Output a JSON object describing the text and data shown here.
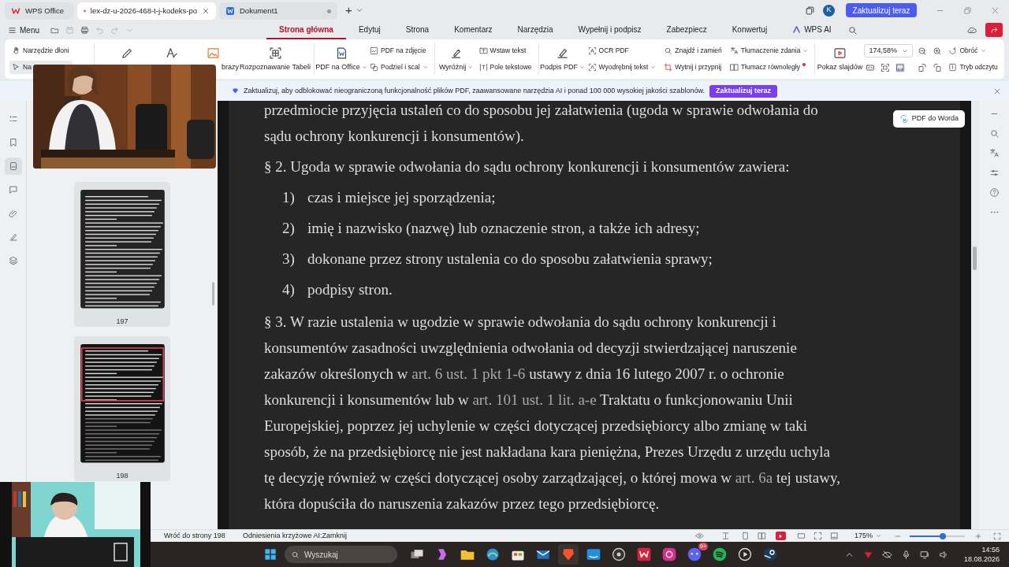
{
  "title_bar": {
    "tabs": [
      {
        "label": "WPS Office",
        "selected": false,
        "close": false,
        "kind": "wps"
      },
      {
        "label": "lex-dz-u-2026-468-t-j-kodeks-po",
        "selected": true,
        "close": true,
        "kind": "pdf"
      },
      {
        "label": "Dokument1",
        "selected": false,
        "close": false,
        "kind": "word"
      }
    ],
    "new_tab": "+",
    "avatar": "K",
    "upgrade_button": "Zaktualizuj teraz"
  },
  "menu_bar": {
    "menu": "Menu",
    "tabs": [
      {
        "label": "Strona główna",
        "selected": true
      },
      {
        "label": "Edytuj",
        "selected": false
      },
      {
        "label": "Strona",
        "selected": false
      },
      {
        "label": "Komentarz",
        "selected": false
      },
      {
        "label": "Narzędzia",
        "selected": false
      },
      {
        "label": "Wypełnij i podpisz",
        "selected": false
      },
      {
        "label": "Zabezpiecz",
        "selected": false
      },
      {
        "label": "Konwertuj",
        "selected": false
      },
      {
        "label": "WPS AI",
        "selected": false
      }
    ]
  },
  "ribbon": {
    "groups": [
      [
        {
          "kind": "col",
          "items": [
            {
              "label": "Narzędzie dłoni",
              "selected": false
            },
            {
              "label": "Na",
              "selected": true
            }
          ]
        }
      ],
      [
        {
          "kind": "big"
        },
        {
          "kind": "big"
        },
        {
          "kind": "partial",
          "label": "brazy"
        },
        {
          "kind": "big",
          "label": "Rozpoznawanie Tabeli"
        }
      ],
      [
        {
          "kind": "big",
          "label": "PDF na Office",
          "dropdown": true
        },
        {
          "kind": "col",
          "items": [
            {
              "label": "PDF na zdjęcie"
            },
            {
              "label": "Podziel i scal",
              "dropdown": true
            }
          ]
        }
      ],
      [
        {
          "kind": "big",
          "label": "Wyróżnij",
          "dropdown": true
        },
        {
          "kind": "col",
          "items": [
            {
              "label": "Wstaw tekst"
            },
            {
              "label": "Pole tekstowe"
            }
          ]
        }
      ],
      [
        {
          "kind": "big",
          "label": "Podpis PDF",
          "dropdown": true
        },
        {
          "kind": "col",
          "items": [
            {
              "label": "OCR PDF"
            },
            {
              "label": "Wyodrębnij tekst",
              "dropdown": true
            }
          ]
        },
        {
          "kind": "col",
          "items": [
            {
              "label": "Znajdź i zamień"
            },
            {
              "label": "Wytnij i przypnij"
            }
          ]
        },
        {
          "kind": "col",
          "items": [
            {
              "label": "Tłumaczenie zdania",
              "dropdown": true
            },
            {
              "label": "Tłumacz równoległy",
              "new": true
            }
          ]
        }
      ],
      [
        {
          "kind": "big",
          "label": "Pokaz slajdów"
        },
        {
          "kind": "zoom",
          "value": "174,58%"
        },
        {
          "kind": "col",
          "items": [
            {
              "label": "Obróć",
              "dropdown": true
            },
            {
              "label": "Tryb odczytu"
            }
          ]
        }
      ]
    ]
  },
  "notice": {
    "text": "Zaktualizuj, aby odblokować nieograniczoną funkcjonalność plików PDF, zaawansowane narzędzia AI i ponad 100 000 wysokiej jakości szablonów.",
    "button": "Zaktualizuj teraz"
  },
  "left_rail": [
    {
      "selected": false
    },
    {
      "selected": false
    },
    {
      "selected": true
    },
    {
      "selected": false
    },
    {
      "selected": false
    },
    {
      "selected": false
    },
    {
      "selected": false
    }
  ],
  "thumbnails": [
    {
      "page": "197",
      "selected": false
    },
    {
      "page": "198",
      "selected": true
    }
  ],
  "document": {
    "blocks": [
      {
        "kind": "para",
        "segments": [
          {
            "text": "przedmiocie przyjęcia ustaleń co do sposobu jej załatwienia (ugoda w sprawie odwołania do sądu ochrony konkurencji i konsumentów)."
          }
        ]
      },
      {
        "kind": "para",
        "segments": [
          {
            "text": "§ 2. Ugoda w sprawie odwołania do sądu ochrony konkurencji i konsumentów zawiera:"
          }
        ]
      },
      {
        "kind": "item",
        "number": "1)",
        "text": "czas i miejsce jej sporządzenia;"
      },
      {
        "kind": "item",
        "number": "2)",
        "text": "imię i nazwisko (nazwę) lub oznaczenie stron, a także ich adresy;"
      },
      {
        "kind": "item",
        "number": "3)",
        "text": "dokonane przez strony ustalenia co do sposobu załatwienia sprawy;"
      },
      {
        "kind": "item",
        "number": "4)",
        "text": "podpisy stron."
      },
      {
        "kind": "para",
        "segments": [
          {
            "text": "§ 3. W razie ustalenia w ugodzie w sprawie odwołania do sądu ochrony konkurencji i konsumentów zasadności uwzględnienia odwołania od decyzji stwierdzającej naruszenie zakazów określonych w "
          },
          {
            "text": "art. 6 ust. 1 pkt 1-6",
            "link": true
          },
          {
            "text": " ustawy z dnia 16 lutego 2007 r. o ochronie konkurencji i konsumentów lub w "
          },
          {
            "text": "art. 101 ust. 1 lit. a-e",
            "link": true
          },
          {
            "text": " Traktatu o funkcjonowaniu Unii Europejskiej, poprzez jej uchylenie w części dotyczącej przedsiębiorcy albo zmianę w taki sposób, że na przedsiębiorcę nie jest nakładana kara pieniężna, Prezes Urzędu z urzędu uchyla tę decyzję również w części dotyczącej osoby zarządzającej, o której mowa w "
          },
          {
            "text": "art. 6a",
            "link": true
          },
          {
            "text": " tej ustawy, która dopuściła do naruszenia zakazów przez tego przedsiębiorcę."
          }
        ]
      }
    ]
  },
  "pdf_to_word": "PDF do Worda",
  "status_bar": {
    "back": "Wróć do strony 198",
    "cross_ref": "Odniesienia krzyżowe AI:Zamknij",
    "zoom": "175%",
    "slider": {
      "level": 0.6
    }
  },
  "taskbar": {
    "search_placeholder": "Wyszukaj",
    "badge": "9+",
    "time": "14:56",
    "date": "18.08.2026"
  }
}
